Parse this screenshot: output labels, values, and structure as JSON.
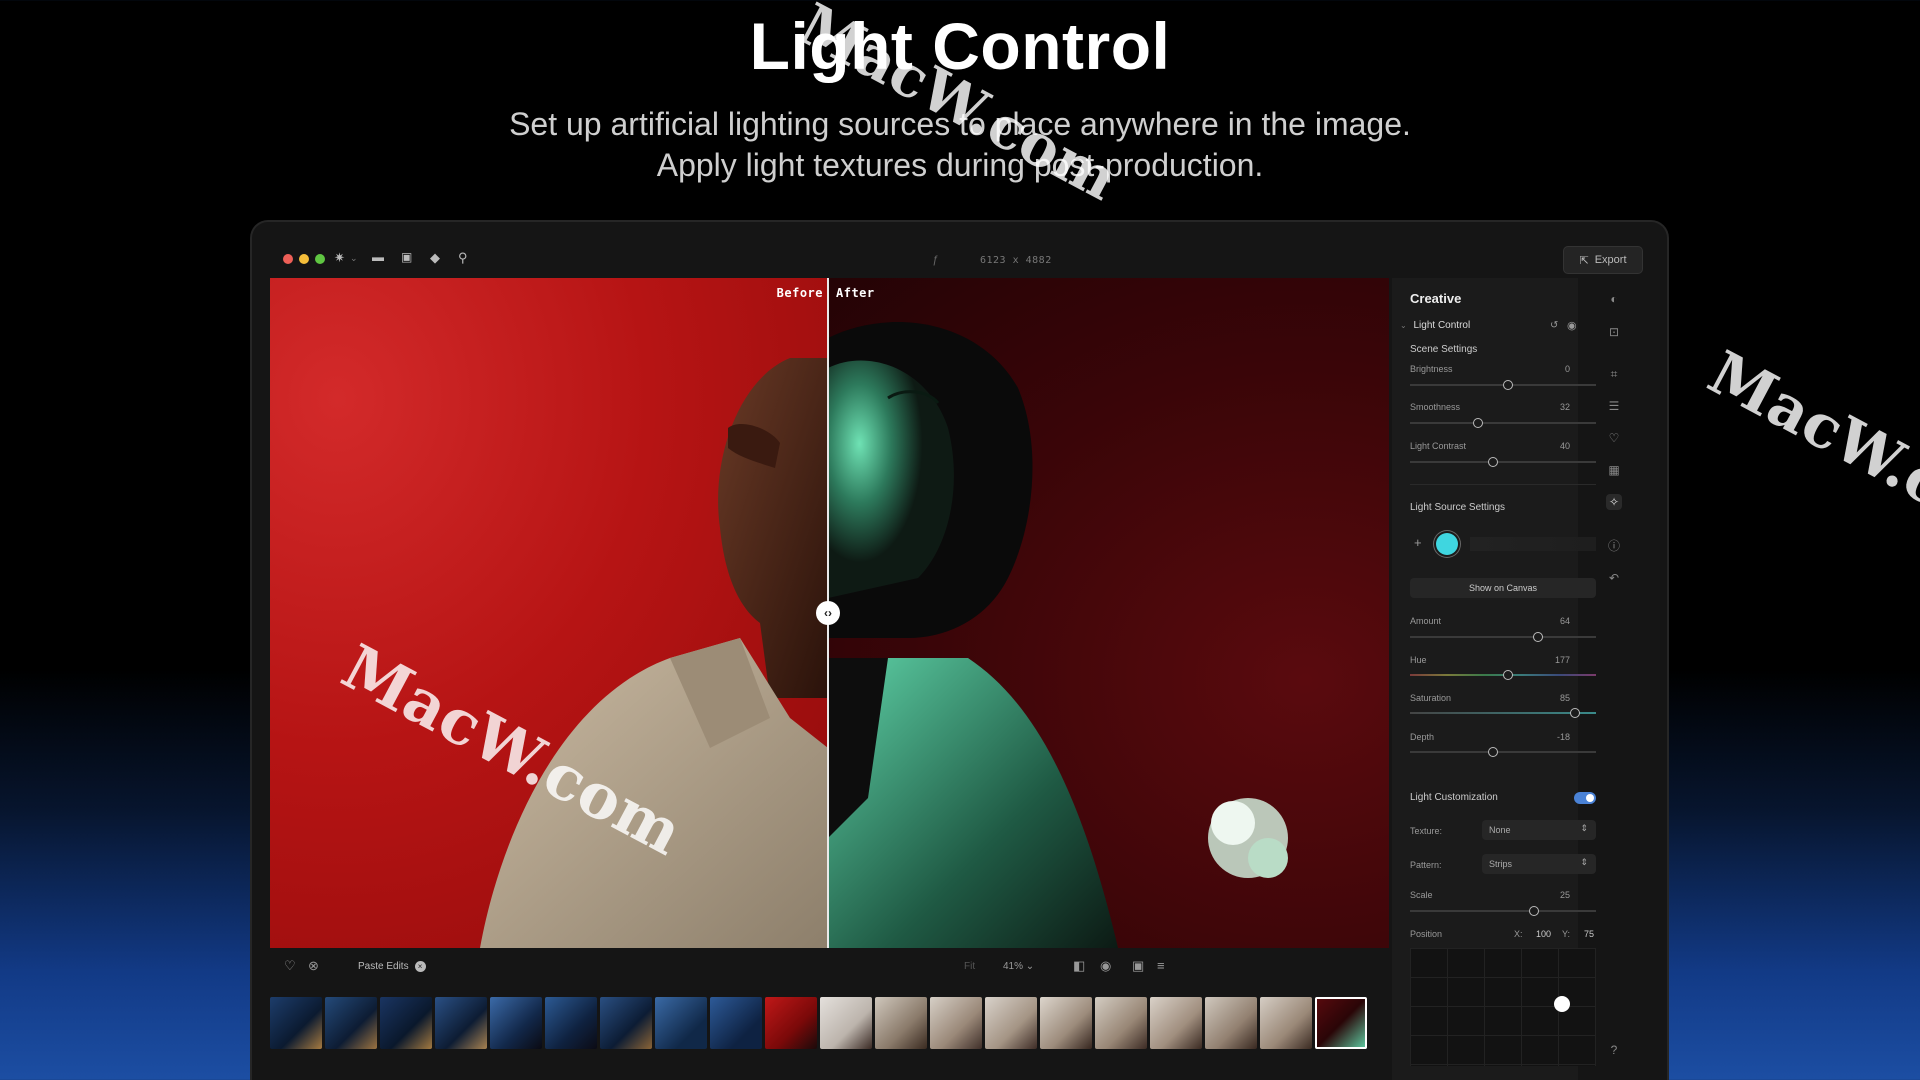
{
  "hero": {
    "title": "Light Control",
    "subtitle_line1": "Set up artificial lighting sources to place anywhere in the image.",
    "subtitle_line2": "Apply light textures during post-production."
  },
  "toolbar": {
    "f_glyph": "ƒ",
    "dimensions": "6123 x 4882",
    "export_label": "Export"
  },
  "canvas": {
    "before_label": "Before",
    "after_label": "After"
  },
  "bottombar": {
    "paste_edits": "Paste Edits",
    "fit": "Fit",
    "zoom": "41%"
  },
  "panel": {
    "title": "Creative",
    "tool_name": "Light Control",
    "scene_settings": "Scene Settings",
    "scene": [
      {
        "label": "Brightness",
        "value": "0",
        "level": 0.5
      },
      {
        "label": "Smoothness",
        "value": "32",
        "level": 0.34
      },
      {
        "label": "Light Contrast",
        "value": "40",
        "level": 0.42
      }
    ],
    "light_source_settings": "Light Source Settings",
    "show_on_canvas": "Show on Canvas",
    "source": [
      {
        "label": "Amount",
        "value": "64",
        "level": 0.66
      },
      {
        "label": "Hue",
        "value": "177",
        "level": 0.5
      },
      {
        "label": "Saturation",
        "value": "85",
        "level": 0.86
      },
      {
        "label": "Depth",
        "value": "-18",
        "level": 0.42
      }
    ],
    "light_customization": "Light Customization",
    "texture_label": "Texture:",
    "texture_value": "None",
    "pattern_label": "Pattern:",
    "pattern_value": "Strips",
    "scale_label": "Scale",
    "scale_value": "25",
    "scale_level": 0.64,
    "position_label": "Position",
    "pos_x_label": "X:",
    "pos_x": "100",
    "pos_y_label": "Y:",
    "pos_y": "75"
  },
  "watermark": "MacW.com",
  "colors": {
    "accent": "#4a82d6",
    "light_source": "#3fd6e0",
    "before_bg": "#b61414",
    "after_bg": "#3a0508",
    "after_glow": "#5fd3a8"
  }
}
